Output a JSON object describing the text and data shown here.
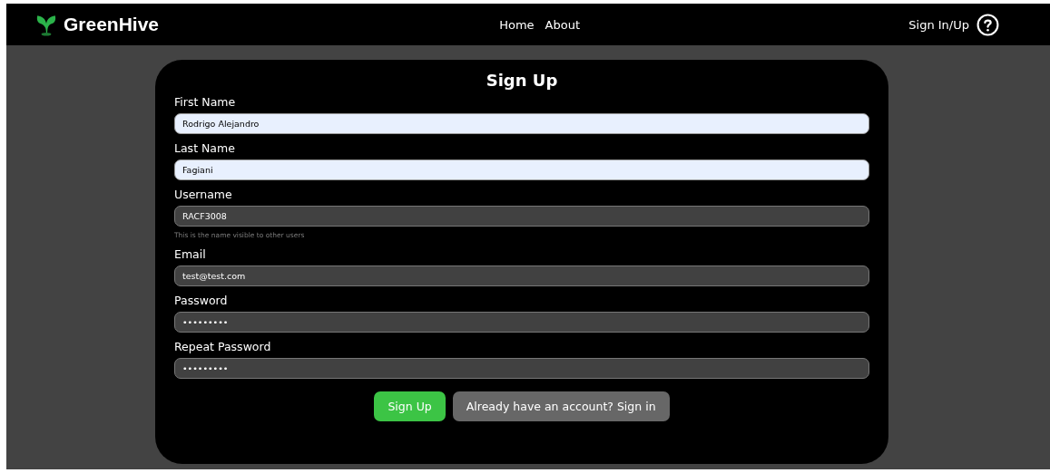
{
  "brand": {
    "name": "GreenHive"
  },
  "nav": {
    "links": [
      "Home",
      "About"
    ],
    "account": "Sign In/Up"
  },
  "form": {
    "title": "Sign Up",
    "fields": [
      {
        "label": "First Name",
        "value": "Rodrigo Alejandro",
        "autofilled": true
      },
      {
        "label": "Last Name",
        "value": "Fagiani",
        "autofilled": true
      },
      {
        "label": "Username",
        "value": "RACF3008",
        "autofilled": false,
        "hint": "This is the name visible to other users"
      },
      {
        "label": "Email",
        "value": "test@test.com",
        "autofilled": false
      },
      {
        "label": "Password",
        "value": "•••••••••",
        "autofilled": false
      },
      {
        "label": "Repeat Password",
        "value": "•••••••••",
        "autofilled": false
      }
    ],
    "buttons": [
      {
        "label": "Sign Up",
        "kind": "primary"
      },
      {
        "label": "Already have an account? Sign in",
        "kind": "secondary"
      }
    ]
  }
}
